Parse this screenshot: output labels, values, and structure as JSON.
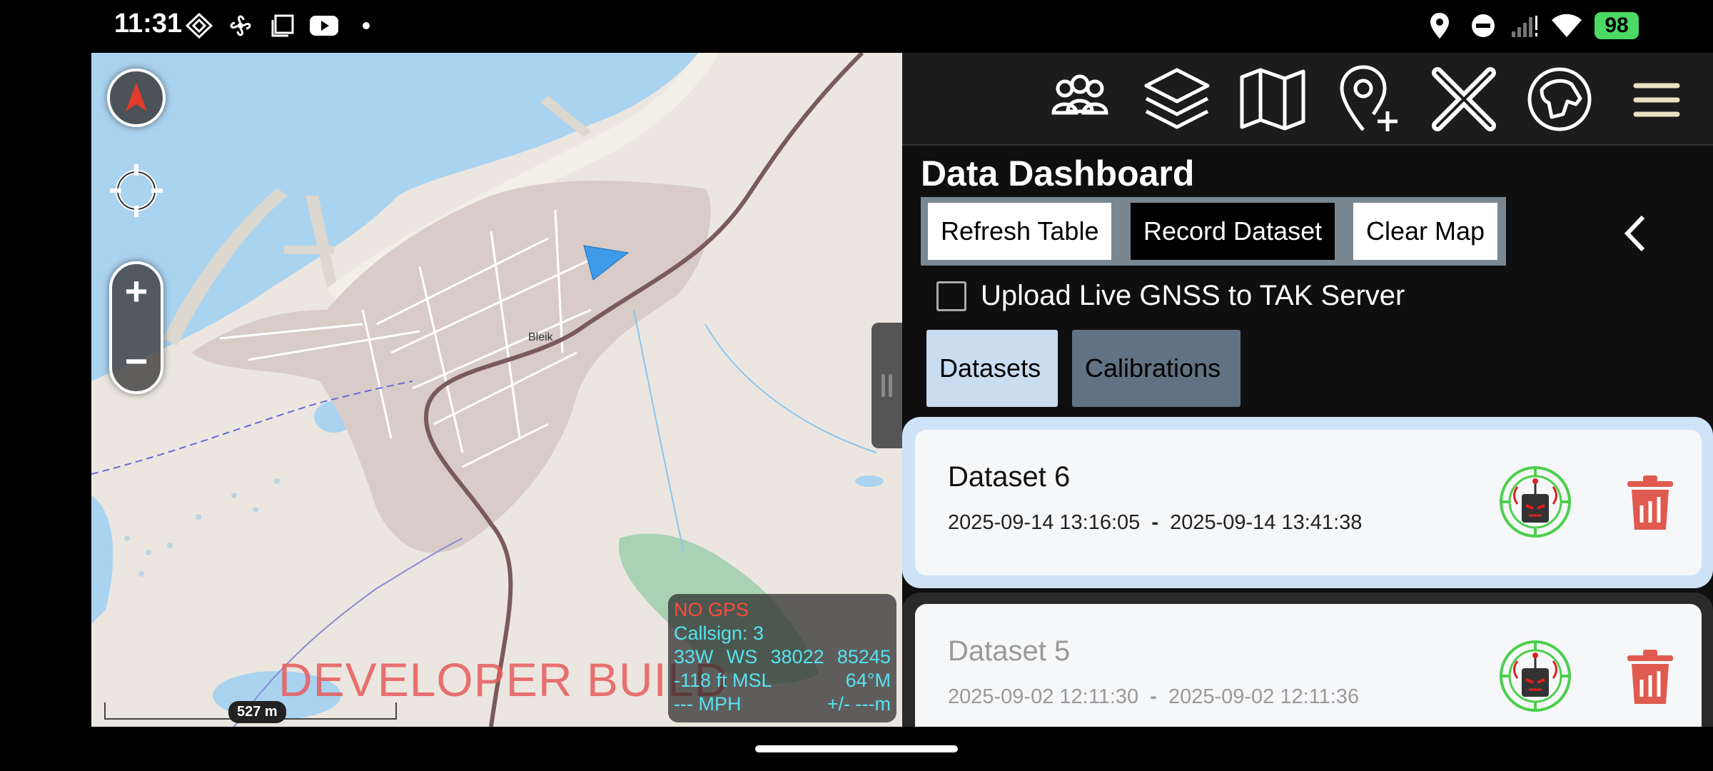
{
  "status_bar": {
    "time": "11:31",
    "battery": "98",
    "icons": [
      "diamond-icon",
      "fan-icon",
      "window-icon",
      "youtube-icon",
      "dot-icon",
      "location-icon",
      "dnd-icon",
      "signal-icon",
      "wifi-icon",
      "battery-icon"
    ]
  },
  "map": {
    "watermark": "DEVELOPER BUILD",
    "scale_label": "527 m",
    "info": {
      "gps_status": "NO GPS",
      "callsign": "Callsign: 3",
      "mgrs_zone": "33W",
      "mgrs_square": "WS",
      "easting": "38022",
      "northing": "85245",
      "altitude": "-118 ft MSL",
      "heading": "64°M",
      "speed": "--- MPH",
      "accuracy": "+/- ---m"
    },
    "label_town": "Bleik"
  },
  "toolbar": {
    "icons": [
      "team-icon",
      "layers-icon",
      "map-icon",
      "add-point-icon",
      "close-icon",
      "dog-tracker-icon",
      "menu-icon"
    ]
  },
  "dashboard": {
    "title": "Data Dashboard",
    "refresh_label": "Refresh Table",
    "record_label": "Record Dataset",
    "clear_label": "Clear Map",
    "upload_label": "Upload Live GNSS to TAK Server",
    "upload_checked": false,
    "tabs": [
      {
        "label": "Datasets",
        "active": true
      },
      {
        "label": "Calibrations",
        "active": false
      }
    ],
    "datasets": [
      {
        "name": "Dataset 6",
        "start": "2025-09-14 13:16:05",
        "sep": "-",
        "end": "2025-09-14 13:41:38",
        "selected": true
      },
      {
        "name": "Dataset 5",
        "start": "2025-09-02 12:11:30",
        "sep": "-",
        "end": "2025-09-02 12:11:36",
        "selected": false
      }
    ]
  },
  "colors": {
    "accent_tab": "#c9dcf0",
    "trash_red": "#e05a4f",
    "emblem_green": "#4ccf4c",
    "water": "#aad3f0",
    "road": "#7a5a5a"
  }
}
